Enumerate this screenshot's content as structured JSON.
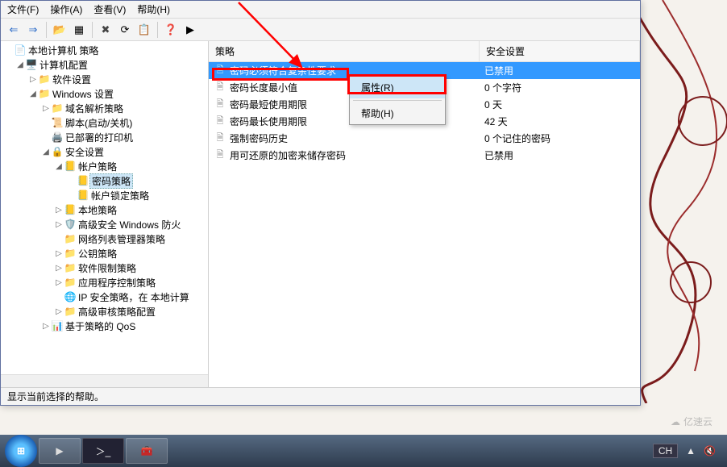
{
  "menu": {
    "file": "文件(F)",
    "action": "操作(A)",
    "view": "查看(V)",
    "help": "帮助(H)"
  },
  "toolbar_icons": {
    "back": "⇐",
    "forward": "⇒",
    "up": "📂",
    "tree": "▦",
    "delete": "✖",
    "refresh": "⟳",
    "export": "📋",
    "help": "❓",
    "play": "▶"
  },
  "tree": {
    "root": "本地计算机 策略",
    "computer": "计算机配置",
    "software": "软件设置",
    "windows": "Windows 设置",
    "dns": "域名解析策略",
    "scripts": "脚本(启动/关机)",
    "printers": "已部署的打印机",
    "security": "安全设置",
    "account": "帐户策略",
    "password": "密码策略",
    "lockout": "帐户锁定策略",
    "local": "本地策略",
    "firewall": "高级安全 Windows 防火",
    "network_list": "网络列表管理器策略",
    "public_key": "公钥策略",
    "software_restrict": "软件限制策略",
    "app_control": "应用程序控制策略",
    "ipsec": "IP 安全策略，在 本地计算",
    "audit": "高级审核策略配置",
    "qos": "基于策略的 QoS"
  },
  "list": {
    "headers": {
      "policy": "策略",
      "setting": "安全设置"
    },
    "rows": [
      {
        "name": "密码必须符合复杂性要求",
        "value": "已禁用"
      },
      {
        "name": "密码长度最小值",
        "value": "0 个字符"
      },
      {
        "name": "密码最短使用期限",
        "value": "0 天"
      },
      {
        "name": "密码最长使用期限",
        "value": "42 天"
      },
      {
        "name": "强制密码历史",
        "value": "0 个记住的密码"
      },
      {
        "name": "用可还原的加密来储存密码",
        "value": "已禁用"
      }
    ]
  },
  "context_menu": {
    "properties": "属性(R)",
    "help": "帮助(H)"
  },
  "status": "显示当前选择的帮助。",
  "tray": {
    "lang": "CH",
    "net": "🔇",
    "flag": "▲"
  },
  "logo": "亿速云"
}
